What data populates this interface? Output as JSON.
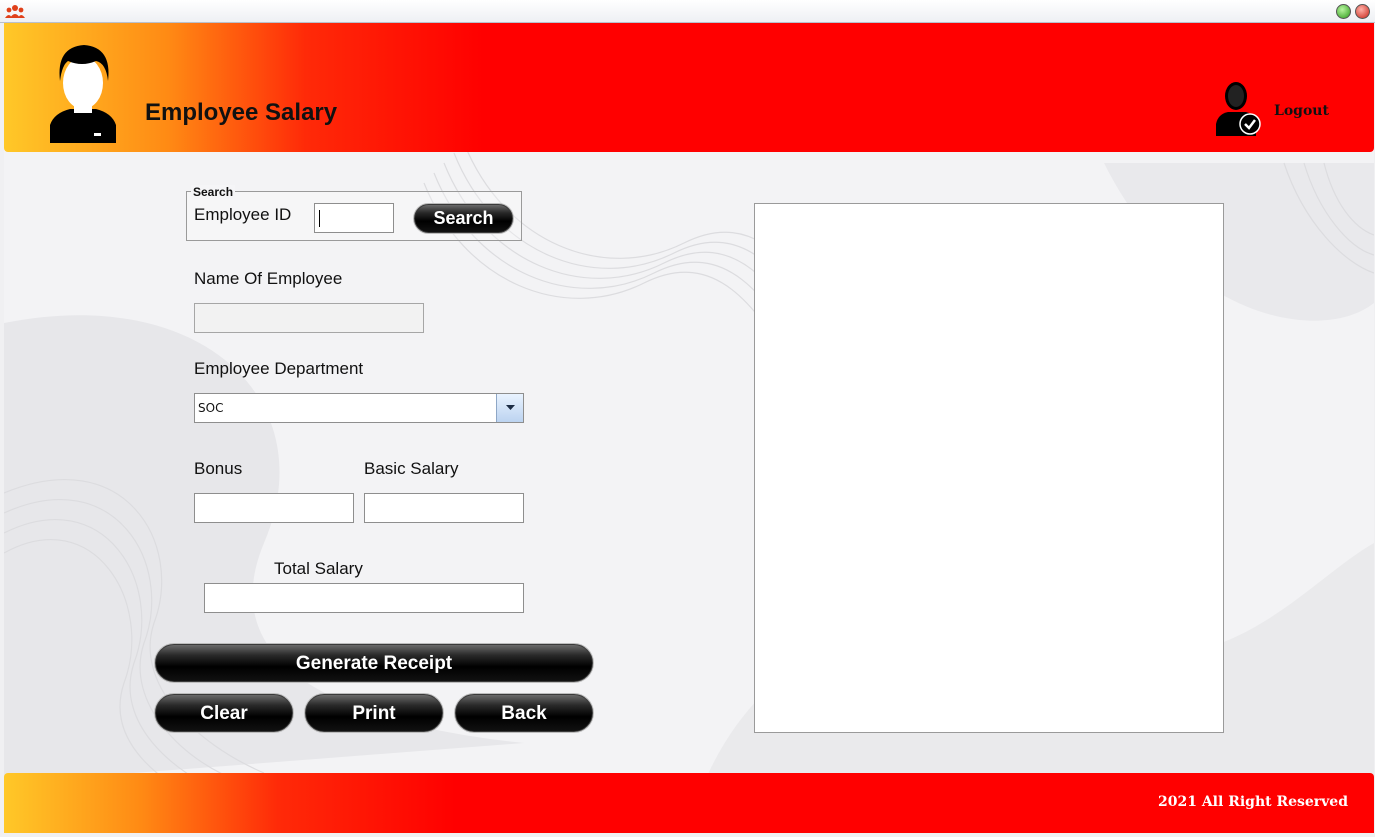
{
  "window": {
    "icon": "group-icon",
    "controls": [
      "minimize-icon",
      "close-icon"
    ]
  },
  "header": {
    "title": "Employee Salary",
    "avatar_icon": "person-icon",
    "logout_label": "Logout",
    "logout_icon": "user-check-icon"
  },
  "search": {
    "legend": "Search",
    "employee_id_label": "Employee ID",
    "employee_id_value": "",
    "button_label": "Search"
  },
  "form": {
    "name_label": "Name Of Employee",
    "name_value": "",
    "department_label": "Employee Department",
    "department_selected": "SOC",
    "bonus_label": "Bonus",
    "bonus_value": "",
    "basic_salary_label": "Basic Salary",
    "basic_salary_value": "",
    "total_salary_label": "Total Salary",
    "total_salary_value": ""
  },
  "buttons": {
    "generate_receipt": "Generate Receipt",
    "clear": "Clear",
    "print": "Print",
    "back": "Back"
  },
  "receipt": {
    "content": ""
  },
  "footer": {
    "text": "2021 All Right Reserved"
  },
  "colors": {
    "header_red": "#ff0000",
    "header_yellow": "#ffc828",
    "button_black": "#000000"
  }
}
